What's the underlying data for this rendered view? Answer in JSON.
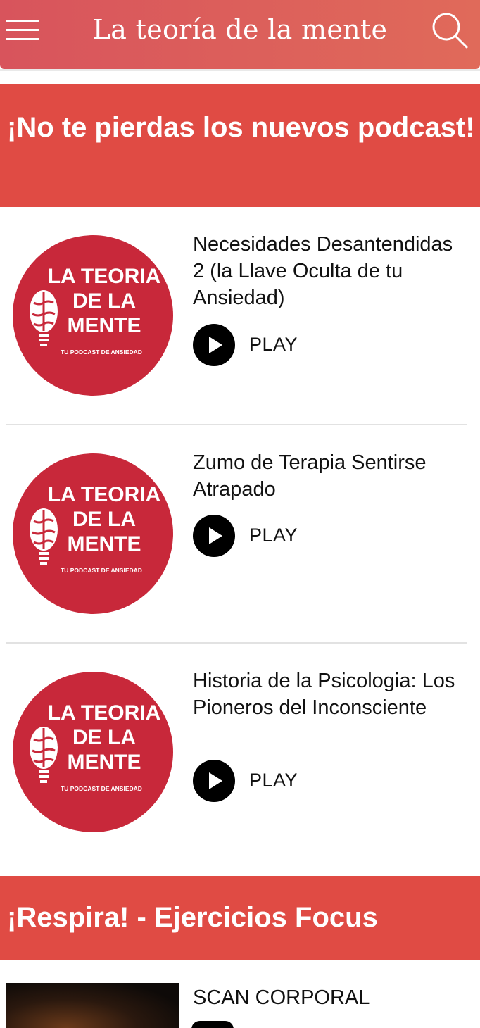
{
  "header": {
    "title": "La teoría de la mente",
    "menu_icon": "hamburger-menu-icon",
    "search_icon": "search-icon",
    "gradient_start": "#d8545c",
    "gradient_end": "#e06a5a"
  },
  "sections": [
    {
      "title": "¡No te pierdas los nuevos podcast!",
      "bg": "#e04b44"
    },
    {
      "title": "¡Respira! - Ejercicios Focus",
      "bg": "#e04b44"
    }
  ],
  "podcast_cover": {
    "line1": "LA TEORIA",
    "line2": "DE LA",
    "line3": "MENTE",
    "tagline": "TU PODCAST DE ANSIEDAD",
    "circle_color": "#c8283a"
  },
  "episodes": [
    {
      "title": "Necesidades Desantendidas 2 (la Llave Oculta de tu Ansiedad)",
      "play_label": "PLAY"
    },
    {
      "title": "Zumo de Terapia Sentirse Atrapado",
      "play_label": "PLAY"
    },
    {
      "title": "Historia de la Psicologia: Los Pioneros del Inconsciente",
      "play_label": "PLAY"
    }
  ],
  "exercises": [
    {
      "title": "SCAN CORPORAL"
    }
  ]
}
